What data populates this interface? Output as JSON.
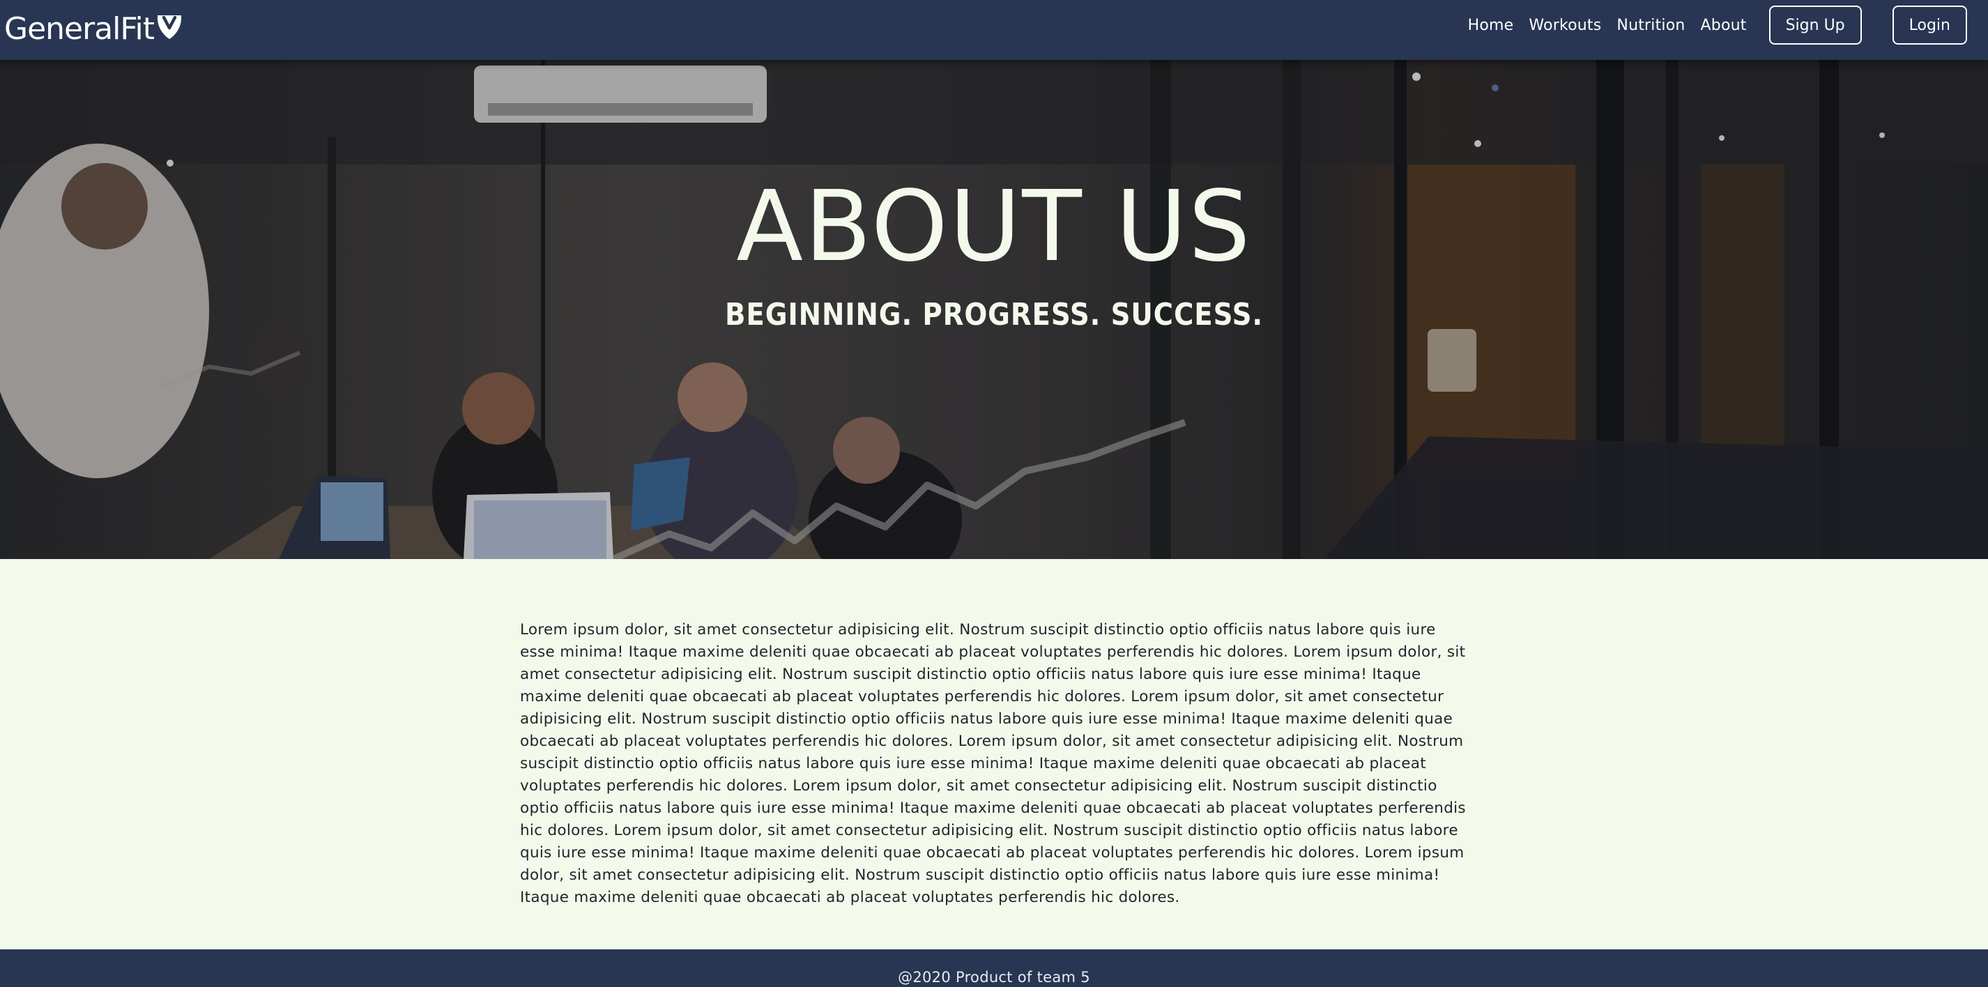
{
  "navbar": {
    "brand": "GeneralFit",
    "links": [
      "Home",
      "Workouts",
      "Nutrition",
      "About"
    ],
    "signup_label": "Sign Up",
    "login_label": "Login",
    "colors": {
      "background": "#283653",
      "text": "#ffffff"
    }
  },
  "hero": {
    "title": "ABOUT US",
    "subtitle": "BEGINNING. PROGRESS. SUCCESS.",
    "image": "office-meeting-photo",
    "text_color": "#f3faec"
  },
  "main": {
    "paragraph": "Lorem ipsum dolor, sit amet consectetur adipisicing elit. Nostrum suscipit distinctio optio officiis natus labore quis iure esse minima! Itaque maxime deleniti quae obcaecati ab placeat voluptates perferendis hic dolores. Lorem ipsum dolor, sit amet consectetur adipisicing elit. Nostrum suscipit distinctio optio officiis natus labore quis iure esse minima! Itaque maxime deleniti quae obcaecati ab placeat voluptates perferendis hic dolores. Lorem ipsum dolor, sit amet consectetur adipisicing elit. Nostrum suscipit distinctio optio officiis natus labore quis iure esse minima! Itaque maxime deleniti quae obcaecati ab placeat voluptates perferendis hic dolores. Lorem ipsum dolor, sit amet consectetur adipisicing elit. Nostrum suscipit distinctio optio officiis natus labore quis iure esse minima! Itaque maxime deleniti quae obcaecati ab placeat voluptates perferendis hic dolores. Lorem ipsum dolor, sit amet consectetur adipisicing elit. Nostrum suscipit distinctio optio officiis natus labore quis iure esse minima! Itaque maxime deleniti quae obcaecati ab placeat voluptates perferendis hic dolores. Lorem ipsum dolor, sit amet consectetur adipisicing elit. Nostrum suscipit distinctio optio officiis natus labore quis iure esse minima! Itaque maxime deleniti quae obcaecati ab placeat voluptates perferendis hic dolores. Lorem ipsum dolor, sit amet consectetur adipisicing elit. Nostrum suscipit distinctio optio officiis natus labore quis iure esse minima! Itaque maxime deleniti quae obcaecati ab placeat voluptates perferendis hic dolores.",
    "background": "#f3faec"
  },
  "footer": {
    "text": "@2020 Product of team 5"
  }
}
